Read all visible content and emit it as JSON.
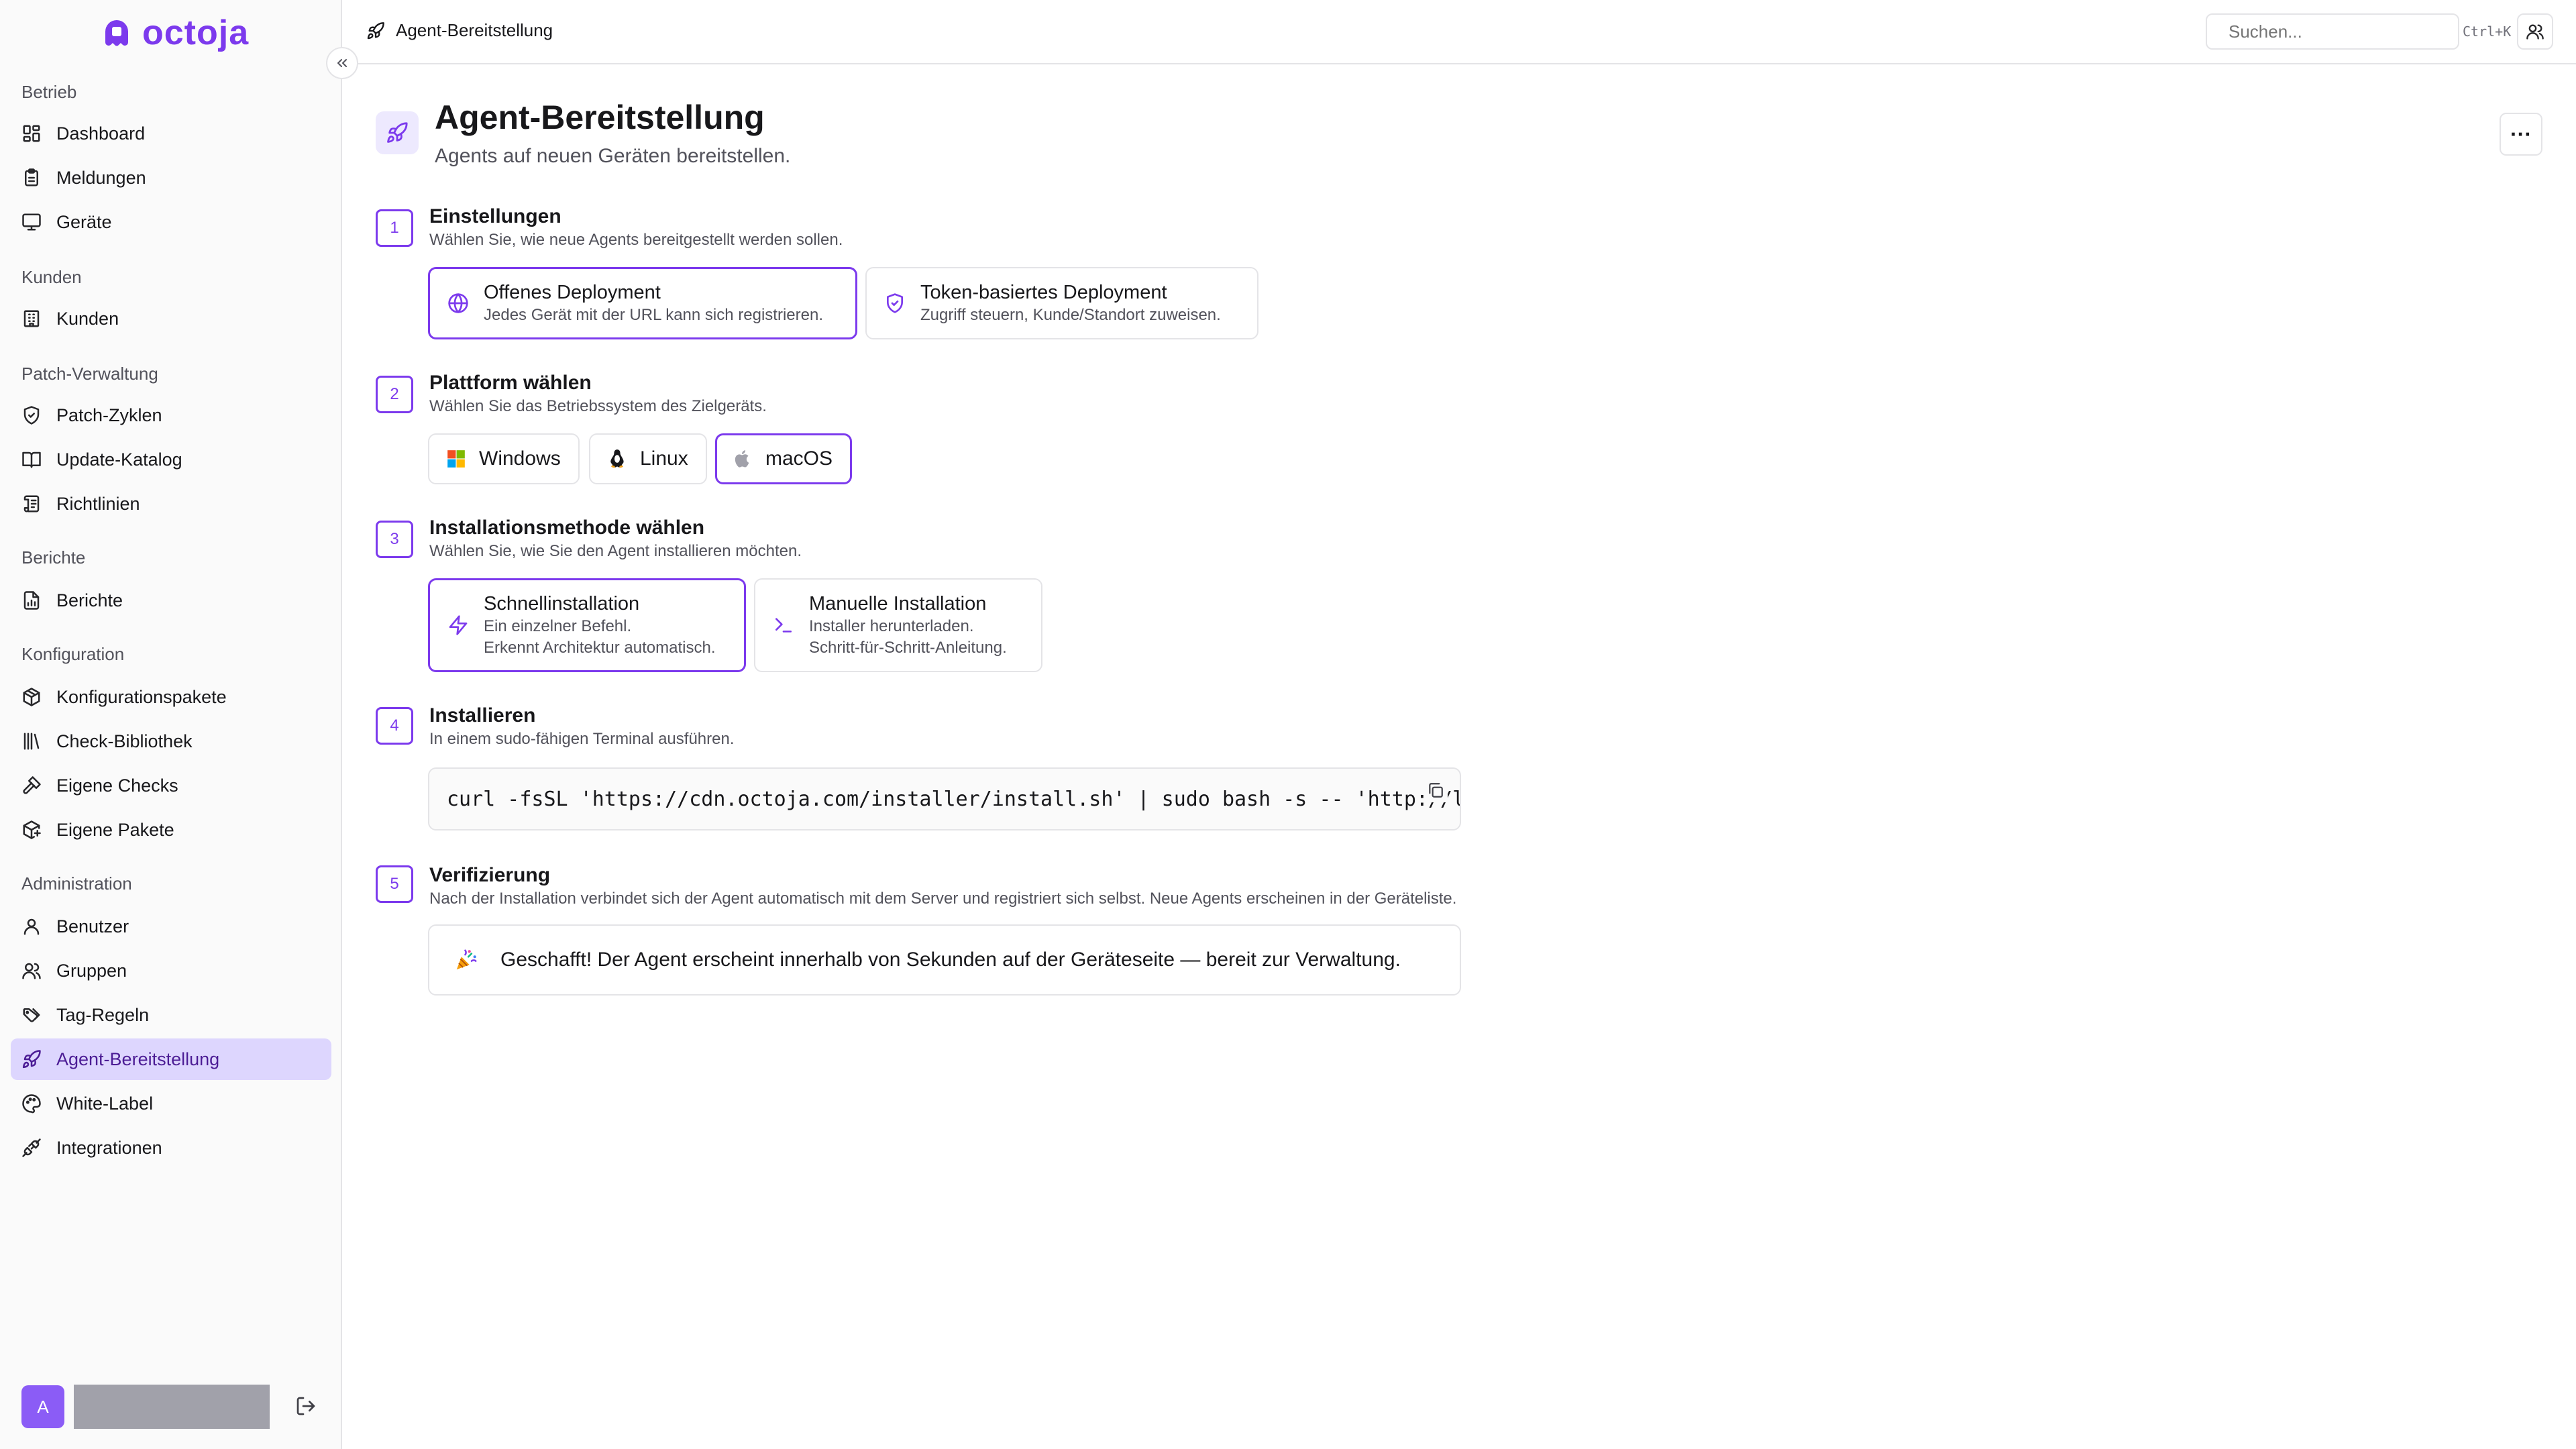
{
  "app": {
    "name": "octoja"
  },
  "sidebar": {
    "sections": [
      {
        "label": "Betrieb",
        "items": [
          {
            "label": "Dashboard",
            "icon": "dashboard-icon"
          },
          {
            "label": "Meldungen",
            "icon": "clipboard-icon"
          },
          {
            "label": "Geräte",
            "icon": "monitor-icon"
          }
        ]
      },
      {
        "label": "Kunden",
        "items": [
          {
            "label": "Kunden",
            "icon": "building-icon"
          }
        ]
      },
      {
        "label": "Patch-Verwaltung",
        "items": [
          {
            "label": "Patch-Zyklen",
            "icon": "shield-check-icon"
          },
          {
            "label": "Update-Katalog",
            "icon": "book-open-icon"
          },
          {
            "label": "Richtlinien",
            "icon": "scroll-icon"
          }
        ]
      },
      {
        "label": "Berichte",
        "items": [
          {
            "label": "Berichte",
            "icon": "file-chart-icon"
          }
        ]
      },
      {
        "label": "Konfiguration",
        "items": [
          {
            "label": "Konfigurationspakete",
            "icon": "package-icon"
          },
          {
            "label": "Check-Bibliothek",
            "icon": "library-icon"
          },
          {
            "label": "Eigene Checks",
            "icon": "hammer-icon"
          },
          {
            "label": "Eigene Pakete",
            "icon": "package-plus-icon"
          }
        ]
      },
      {
        "label": "Administration",
        "items": [
          {
            "label": "Benutzer",
            "icon": "user-icon"
          },
          {
            "label": "Gruppen",
            "icon": "users-icon"
          },
          {
            "label": "Tag-Regeln",
            "icon": "tags-icon"
          },
          {
            "label": "Agent-Bereitstellung",
            "icon": "rocket-icon",
            "active": true
          },
          {
            "label": "White-Label",
            "icon": "palette-icon"
          },
          {
            "label": "Integrationen",
            "icon": "plug-icon"
          }
        ]
      }
    ],
    "user": {
      "avatar_initial": "A"
    }
  },
  "header": {
    "breadcrumb": "Agent-Bereitstellung",
    "search_placeholder": "Suchen...",
    "search_shortcut": "Ctrl+K"
  },
  "page": {
    "title": "Agent-Bereitstellung",
    "subtitle": "Agents auf neuen Geräten bereitstellen.",
    "more": "···"
  },
  "steps": [
    {
      "num": "1",
      "title": "Einstellungen",
      "desc": "Wählen Sie, wie neue Agents bereitgestellt werden sollen.",
      "options": [
        {
          "title": "Offenes Deployment",
          "desc": "Jedes Gerät mit der URL kann sich registrieren.",
          "selected": true
        },
        {
          "title": "Token-basiertes Deployment",
          "desc": "Zugriff steuern, Kunde/Standort zuweisen.",
          "selected": false
        }
      ]
    },
    {
      "num": "2",
      "title": "Plattform wählen",
      "desc": "Wählen Sie das Betriebssystem des Zielgeräts.",
      "options": [
        {
          "label": "Windows",
          "icon": "windows-icon",
          "selected": false
        },
        {
          "label": "Linux",
          "icon": "linux-icon",
          "selected": false
        },
        {
          "label": "macOS",
          "icon": "apple-icon",
          "selected": true
        }
      ]
    },
    {
      "num": "3",
      "title": "Installationsmethode wählen",
      "desc": "Wählen Sie, wie Sie den Agent installieren möchten.",
      "options": [
        {
          "title": "Schnellinstallation",
          "desc1": "Ein einzelner Befehl.",
          "desc2": "Erkennt Architektur automatisch.",
          "selected": true
        },
        {
          "title": "Manuelle Installation",
          "desc1": "Installer herunterladen.",
          "desc2": "Schritt-für-Schritt-Anleitung.",
          "selected": false
        }
      ]
    },
    {
      "num": "4",
      "title": "Installieren",
      "desc": "In einem sudo-fähigen Terminal ausführen.",
      "command": "curl -fsSL 'https://cdn.octoja.com/installer/install.sh' | sudo bash -s -- 'http://localhost"
    },
    {
      "num": "5",
      "title": "Verifizierung",
      "desc": "Nach der Installation verbindet sich der Agent automatisch mit dem Server und registriert sich selbst. Neue Agents erscheinen in der Geräteliste.",
      "success": "Geschafft! Der Agent erscheint innerhalb von Sekunden auf der Geräteseite — bereit zur Verwaltung."
    }
  ],
  "colors": {
    "accent": "#7c3aed",
    "active_bg": "#ddd6fe",
    "border": "#e4e4e7"
  }
}
